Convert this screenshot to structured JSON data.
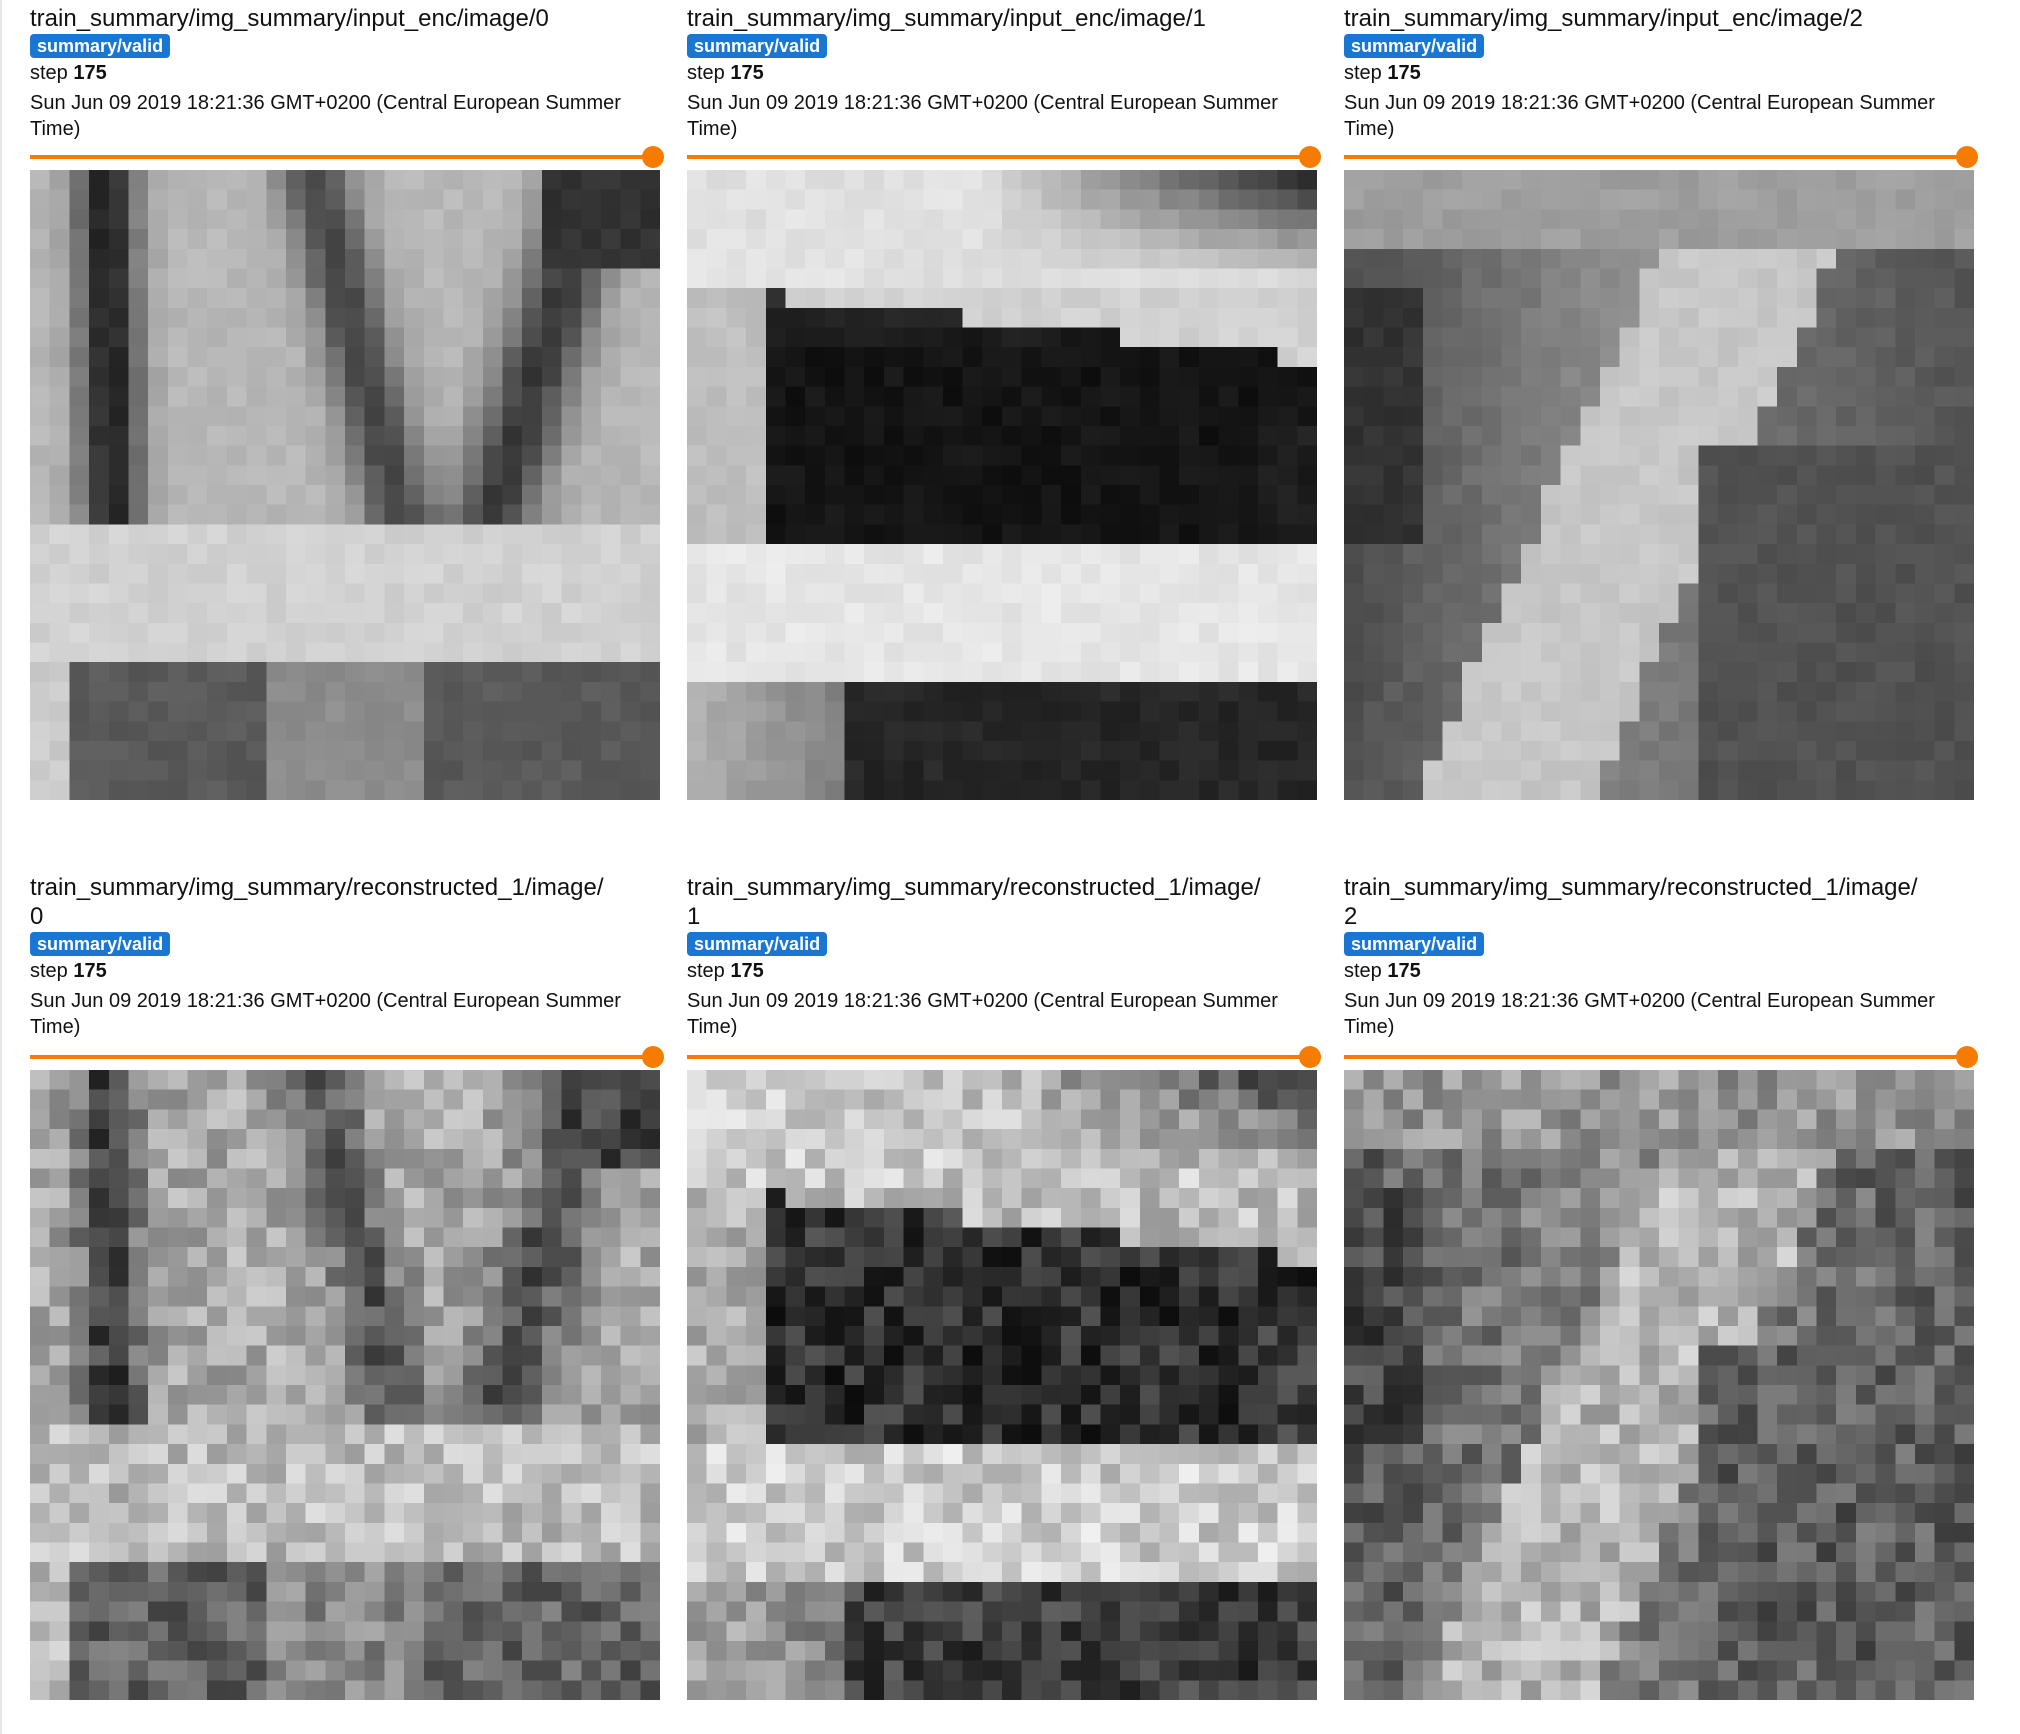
{
  "cards": [
    {
      "title": "train_summary/img_summary/input_enc/image/0",
      "tag": "summary/valid",
      "step_label": "step",
      "step_value": "175",
      "timestamp": "Sun Jun 09 2019 18:21:36 GMT+0200 (Central European Summer Time)",
      "image_kind": "input"
    },
    {
      "title": "train_summary/img_summary/input_enc/image/1",
      "tag": "summary/valid",
      "step_label": "step",
      "step_value": "175",
      "timestamp": "Sun Jun 09 2019 18:21:36 GMT+0200 (Central European Summer Time)",
      "image_kind": "input"
    },
    {
      "title": "train_summary/img_summary/input_enc/image/2",
      "tag": "summary/valid",
      "step_label": "step",
      "step_value": "175",
      "timestamp": "Sun Jun 09 2019 18:21:36 GMT+0200 (Central European Summer Time)",
      "image_kind": "input"
    },
    {
      "title": "train_summary/img_summary/reconstructed_1/image/\n0",
      "tag": "summary/valid",
      "step_label": "step",
      "step_value": "175",
      "timestamp": "Sun Jun 09 2019 18:21:36 GMT+0200 (Central European Summer Time)",
      "image_kind": "reconstructed"
    },
    {
      "title": "train_summary/img_summary/reconstructed_1/image/\n1",
      "tag": "summary/valid",
      "step_label": "step",
      "step_value": "175",
      "timestamp": "Sun Jun 09 2019 18:21:36 GMT+0200 (Central European Summer Time)",
      "image_kind": "reconstructed"
    },
    {
      "title": "train_summary/img_summary/reconstructed_1/image/\n2",
      "tag": "summary/valid",
      "step_label": "step",
      "step_value": "175",
      "timestamp": "Sun Jun 09 2019 18:21:36 GMT+0200 (Central European Summer Time)",
      "image_kind": "reconstructed"
    }
  ],
  "colors": {
    "tag_bg": "#1976d2",
    "slider": "#f57c00"
  },
  "slider_value": 1.0
}
